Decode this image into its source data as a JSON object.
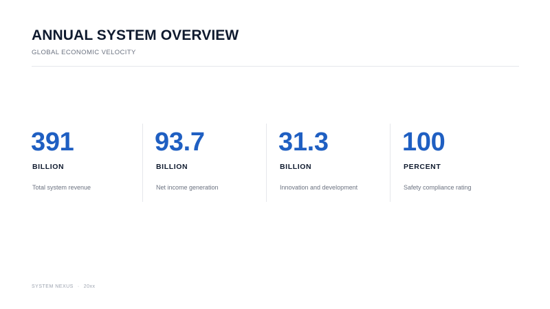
{
  "header": {
    "title": "ANNUAL SYSTEM OVERVIEW",
    "subtitle": "GLOBAL ECONOMIC VELOCITY"
  },
  "stats": [
    {
      "value": "391",
      "unit": "BILLION",
      "description": "Total system revenue"
    },
    {
      "value": "93.7",
      "unit": "BILLION",
      "description": "Net income generation"
    },
    {
      "value": "31.3",
      "unit": "BILLION",
      "description": "Innovation and development"
    },
    {
      "value": "100",
      "unit": "PERCENT",
      "description": "Safety compliance rating"
    }
  ],
  "footer": {
    "brand": "SYSTEM NEXUS",
    "separator": "·",
    "year": "20xx"
  },
  "colors": {
    "accent": "#1f5fc2",
    "heading": "#0f1a2e",
    "muted": "#6b7280",
    "divider": "#e5e7eb"
  }
}
